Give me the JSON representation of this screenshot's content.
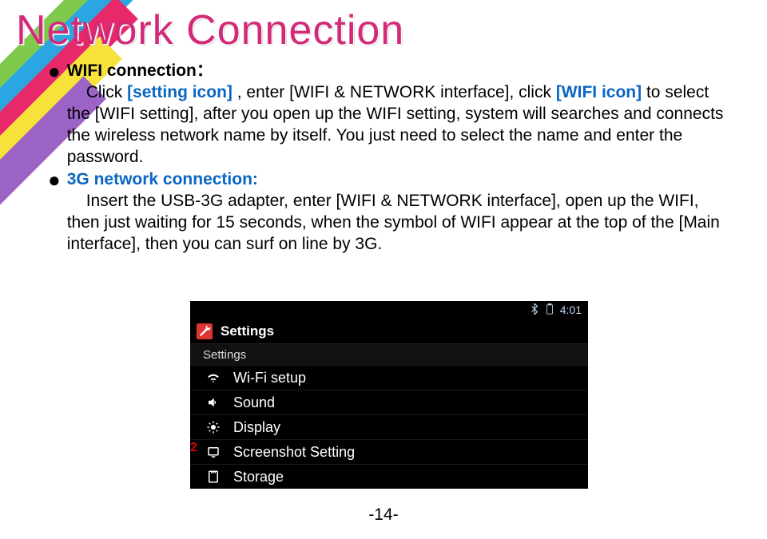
{
  "title": "Network Connection",
  "sections": [
    {
      "heading": "WIFI connection：",
      "heading_color": "black",
      "body_prefix": "Click ",
      "link1": "[setting icon]",
      "body_mid1": " , enter [WIFI & NETWORK interface], click ",
      "link2": "[WIFI icon]",
      "body_mid2": " to select the [WIFI setting], after you open up the WIFI setting, system will searches and connects the wireless network name by itself. You just need to select the name and enter the password."
    },
    {
      "heading": "3G network connection:",
      "heading_color": "blue",
      "body": "Insert the USB-3G adapter, enter [WIFI & NETWORK interface], open up the WIFI, then just waiting for 15 seconds, when the symbol of WIFI appear at the top of the [Main interface], then you can surf on line by 3G."
    }
  ],
  "android": {
    "clock": "4:01",
    "topbar_title": "Settings",
    "section_label": "Settings",
    "rows": [
      {
        "icon": "wifi",
        "label": "Wi-Fi setup"
      },
      {
        "icon": "sound",
        "label": "Sound"
      },
      {
        "icon": "display",
        "label": "Display"
      },
      {
        "icon": "screenshot",
        "label": "Screenshot Setting"
      },
      {
        "icon": "storage",
        "label": "Storage"
      }
    ]
  },
  "corner_number": "2",
  "page_number": "-14-"
}
